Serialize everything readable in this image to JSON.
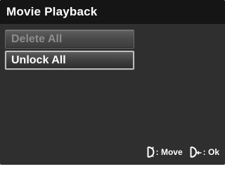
{
  "title": "Movie Playback",
  "menu": {
    "items": [
      {
        "label": "Delete All",
        "state": "disabled"
      },
      {
        "label": "Unlock All",
        "state": "selected"
      }
    ]
  },
  "footer": {
    "move_label": ": Move",
    "ok_label": ": Ok",
    "move_icon": "dpad-up-down-icon",
    "ok_icon": "dpad-enter-icon"
  },
  "colors": {
    "background": "#2f2f2f",
    "title_bar": "#151515",
    "text": "#ffffff",
    "disabled_text": "#8d8d8d",
    "selected_border": "#bdbdbd"
  }
}
